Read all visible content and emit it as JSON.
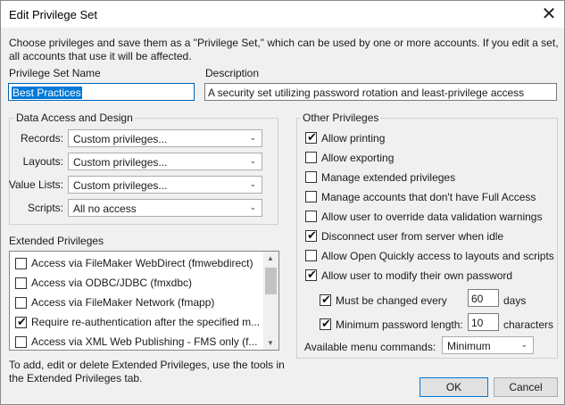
{
  "window": {
    "title": "Edit Privilege Set",
    "close_glyph": "✕"
  },
  "intro_text": "Choose privileges and save them as a \"Privilege Set,\" which can be used by one or more accounts. If you edit a set, all accounts that use it will be affected.",
  "name_field": {
    "label": "Privilege Set Name",
    "value": "Best Practices"
  },
  "description_field": {
    "label": "Description",
    "value": "A security set utilizing password rotation and least-privilege access"
  },
  "data_access": {
    "group_label": "Data Access and Design",
    "rows": [
      {
        "label": "Records:",
        "value": "Custom privileges..."
      },
      {
        "label": "Layouts:",
        "value": "Custom privileges..."
      },
      {
        "label": "Value Lists:",
        "value": "Custom privileges..."
      },
      {
        "label": "Scripts:",
        "value": "All no access"
      }
    ]
  },
  "extended_privileges": {
    "label": "Extended Privileges",
    "items": [
      {
        "label": "Access via FileMaker WebDirect (fmwebdirect)",
        "checked": false
      },
      {
        "label": "Access via ODBC/JDBC (fmxdbc)",
        "checked": false
      },
      {
        "label": "Access via FileMaker Network (fmapp)",
        "checked": false
      },
      {
        "label": "Require re-authentication after the specified m...",
        "checked": true
      },
      {
        "label": "Access via XML Web Publishing - FMS only (f...",
        "checked": false
      }
    ],
    "help_text": "To add, edit or delete Extended Privileges, use the tools in the Extended Privileges tab."
  },
  "other_privileges": {
    "group_label": "Other Privileges",
    "items": [
      {
        "label": "Allow printing",
        "checked": true
      },
      {
        "label": "Allow exporting",
        "checked": false
      },
      {
        "label": "Manage extended privileges",
        "checked": false
      },
      {
        "label": "Manage accounts that don't have Full Access",
        "checked": false
      },
      {
        "label": "Allow user to override data validation warnings",
        "checked": false
      },
      {
        "label": "Disconnect user from server when idle",
        "checked": true
      },
      {
        "label": "Allow Open Quickly access to layouts and scripts",
        "checked": false
      },
      {
        "label": "Allow user to modify their own password",
        "checked": true
      }
    ],
    "password_change": {
      "label": "Must be changed every",
      "checked": true,
      "value": "60",
      "unit": "days"
    },
    "password_length": {
      "label": "Minimum password length:",
      "checked": true,
      "value": "10",
      "unit": "characters"
    },
    "menu_commands": {
      "label": "Available menu commands:",
      "value": "Minimum"
    }
  },
  "buttons": {
    "ok": "OK",
    "cancel": "Cancel"
  },
  "check_glyph": "✔",
  "arrow_glyph": "⌄",
  "scroll_up_glyph": "▲",
  "scroll_down_glyph": "▼"
}
